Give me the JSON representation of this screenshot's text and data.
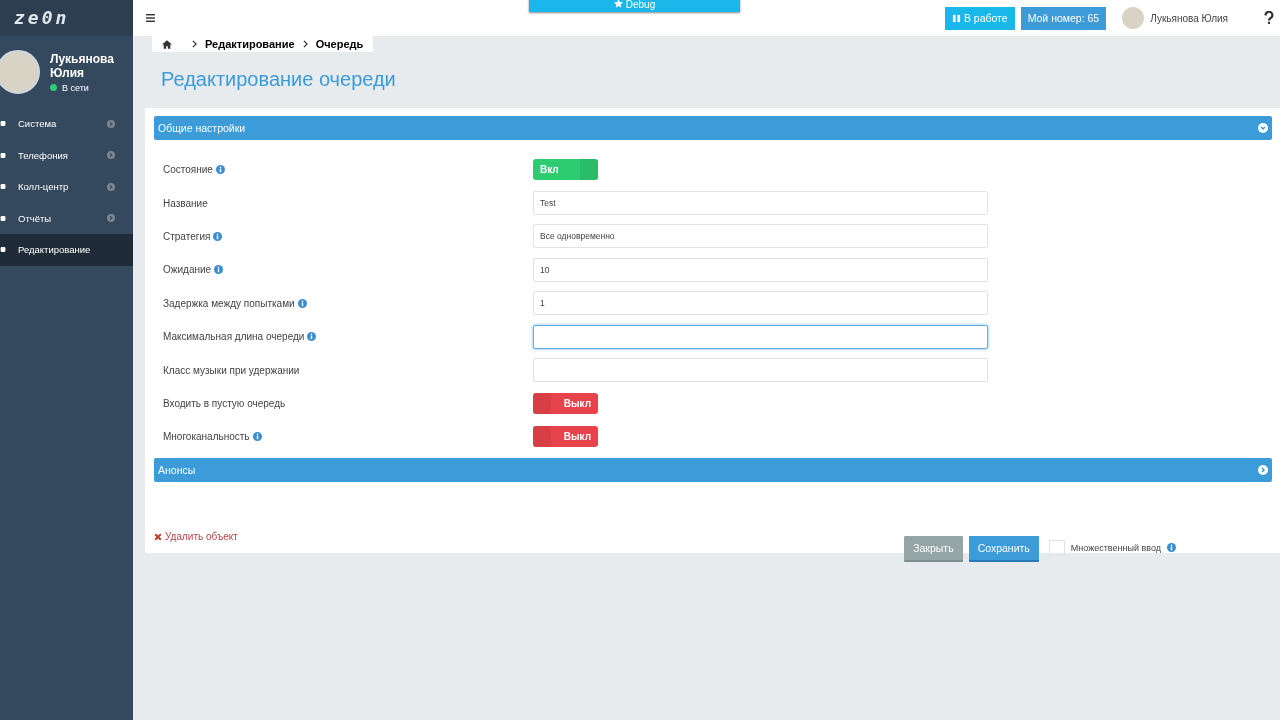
{
  "logo": "ze0n",
  "debug_button": "Debug",
  "top_buttons": [
    {
      "label": "В работе",
      "kind": "status"
    },
    {
      "label": "Мой номер: 65",
      "kind": "number"
    }
  ],
  "user": {
    "name": "Лукьянова Юлия"
  },
  "profile": {
    "name": "Лукьянова Юлия",
    "status": "В сети"
  },
  "sidebar": {
    "items": [
      {
        "label": "Система",
        "selected": false,
        "expandable": true
      },
      {
        "label": "Телефония",
        "selected": false,
        "expandable": true
      },
      {
        "label": "Колл-центр",
        "selected": false,
        "expandable": true
      },
      {
        "label": "Отчёты",
        "selected": false,
        "expandable": true
      },
      {
        "label": "Редактирование",
        "selected": true,
        "expandable": false
      }
    ]
  },
  "breadcrumb": [
    "Редактирование",
    "Очередь"
  ],
  "page_title": "Редактирование очереди",
  "sections": [
    {
      "title": "Общие настройки",
      "expanded": true,
      "fields": [
        {
          "kind": "toggle",
          "label": "Состояние",
          "info": true,
          "on": true,
          "text": "Вкл"
        },
        {
          "kind": "input",
          "label": "Название",
          "info": false,
          "value": "Test",
          "focused": false
        },
        {
          "kind": "input",
          "label": "Стратегия",
          "info": true,
          "value": "Все одновременно",
          "focused": false
        },
        {
          "kind": "input",
          "label": "Ожидание",
          "info": true,
          "value": "10",
          "focused": false
        },
        {
          "kind": "input",
          "label": "Задержка между попытками",
          "info": true,
          "value": "1",
          "focused": false
        },
        {
          "kind": "input",
          "label": "Максимальная длина очереди",
          "info": true,
          "focused": true
        },
        {
          "kind": "input",
          "label": "Класс музыки при удержании",
          "info": false,
          "focused": false
        },
        {
          "kind": "toggle",
          "label": "Входить в пустую очередь",
          "info": false,
          "on": false,
          "text": "Выкл"
        },
        {
          "kind": "toggle",
          "label": "Многоканальность",
          "info": true,
          "on": false,
          "text": "Выкл"
        }
      ]
    },
    {
      "title": "Анонсы",
      "expanded": false
    }
  ],
  "delete_link": "Удалить объект",
  "close_button": "Закрыть",
  "save_button": "Сохранить",
  "multi_input": {
    "label": "Множественный ввод",
    "checked": false
  }
}
